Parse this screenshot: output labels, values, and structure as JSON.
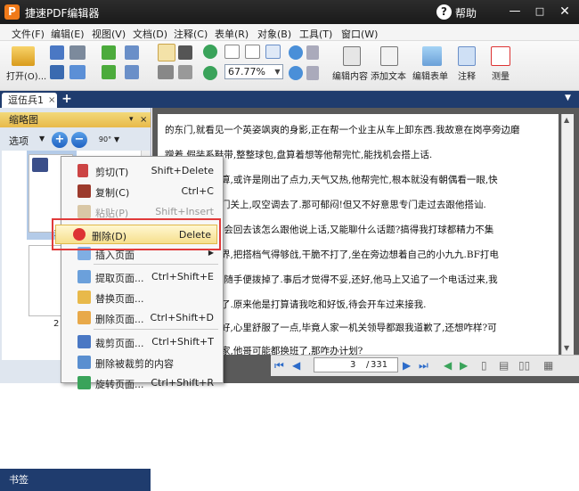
{
  "app": {
    "logo": "P",
    "title": "捷速PDF编辑器",
    "help": "帮助",
    "min": "—",
    "max": "□",
    "close": "✕"
  },
  "menu": [
    "文件(F)",
    "编辑(E)",
    "视图(V)",
    "文档(D)",
    "注释(C)",
    "表单(R)",
    "对象(B)",
    "工具(T)",
    "窗口(W)"
  ],
  "toolbar": {
    "open_label": "打开(O)...",
    "zoom_value": "67.77%",
    "edit_content": "编辑内容",
    "add_text": "添加文本",
    "edit_form": "编辑表单",
    "annotate": "注释",
    "measure": "测量"
  },
  "tabs": {
    "doc_tab": "逗伍兵1",
    "close": "×",
    "add": "+",
    "dropdown": "▼"
  },
  "panel": {
    "title": "缩略图",
    "options": "选项",
    "rotate": "90°",
    "pages": [
      "1",
      "2"
    ],
    "bottom_tab": "书签",
    "pin": "▾",
    "close": "×"
  },
  "document": {
    "lines": [
      "的东门,就看见一个英姿飒爽的身影,正在帮一个业主从车上卸东西.我故意在岗亭旁边磨",
      "蹭着,假装系鞋带,整整球包,盘算着想等他帮完忙,能找机会搭上话.",
      "　　　　如天算,或许是刚出了点力,天气又热,他帮完忙,根本就没有朝偶看一眼,快",
      "　　　　手把门关上,叹空调去了.那可郁闷!但又不好意思专门走过去跟他搭讪.",
      "　　　　想,待会回去该怎么跟他说上话,又能聊什么话题?搞得我打球都精力不集",
      "　　　　是出界,把搭档气得够戗,干脆不打了,坐在旁边想着自己的小九九.BF打电",
      "　　　　没想,随手便拨掉了.事后才觉得不妥,还好,他马上又追了一个电话过来,我",
      "　　　　精键了.原来他是打算请我吃和好饭,待会开车过来接我.",
      "　　　　动和好,心里舒服了一点,毕竟人家一机关领导都跟我道歉了,还想咋样?可",
      "　　　　回到家,他哥可能都换班了,那咋办计划?"
    ]
  },
  "status": {
    "current_page": "3",
    "sep": "/",
    "total_pages": "331"
  },
  "context_menu": {
    "items": [
      {
        "label": "剪切(T)",
        "shortcut": "Shift+Delete"
      },
      {
        "label": "复制(C)",
        "shortcut": "Ctrl+C"
      },
      {
        "label": "粘贴(P)",
        "shortcut": "Shift+Insert"
      },
      {
        "label": "删除(D)",
        "shortcut": "Delete"
      },
      {
        "label": "插入页面",
        "shortcut": ""
      },
      {
        "label": "提取页面...",
        "shortcut": "Ctrl+Shift+E"
      },
      {
        "label": "替换页面...",
        "shortcut": ""
      },
      {
        "label": "删除页面...",
        "shortcut": "Ctrl+Shift+D"
      },
      {
        "label": "裁剪页面...",
        "shortcut": "Ctrl+Shift+T"
      },
      {
        "label": "删除被裁剪的内容",
        "shortcut": ""
      },
      {
        "label": "旋转页面...",
        "shortcut": "Ctrl+Shift+R"
      }
    ]
  }
}
